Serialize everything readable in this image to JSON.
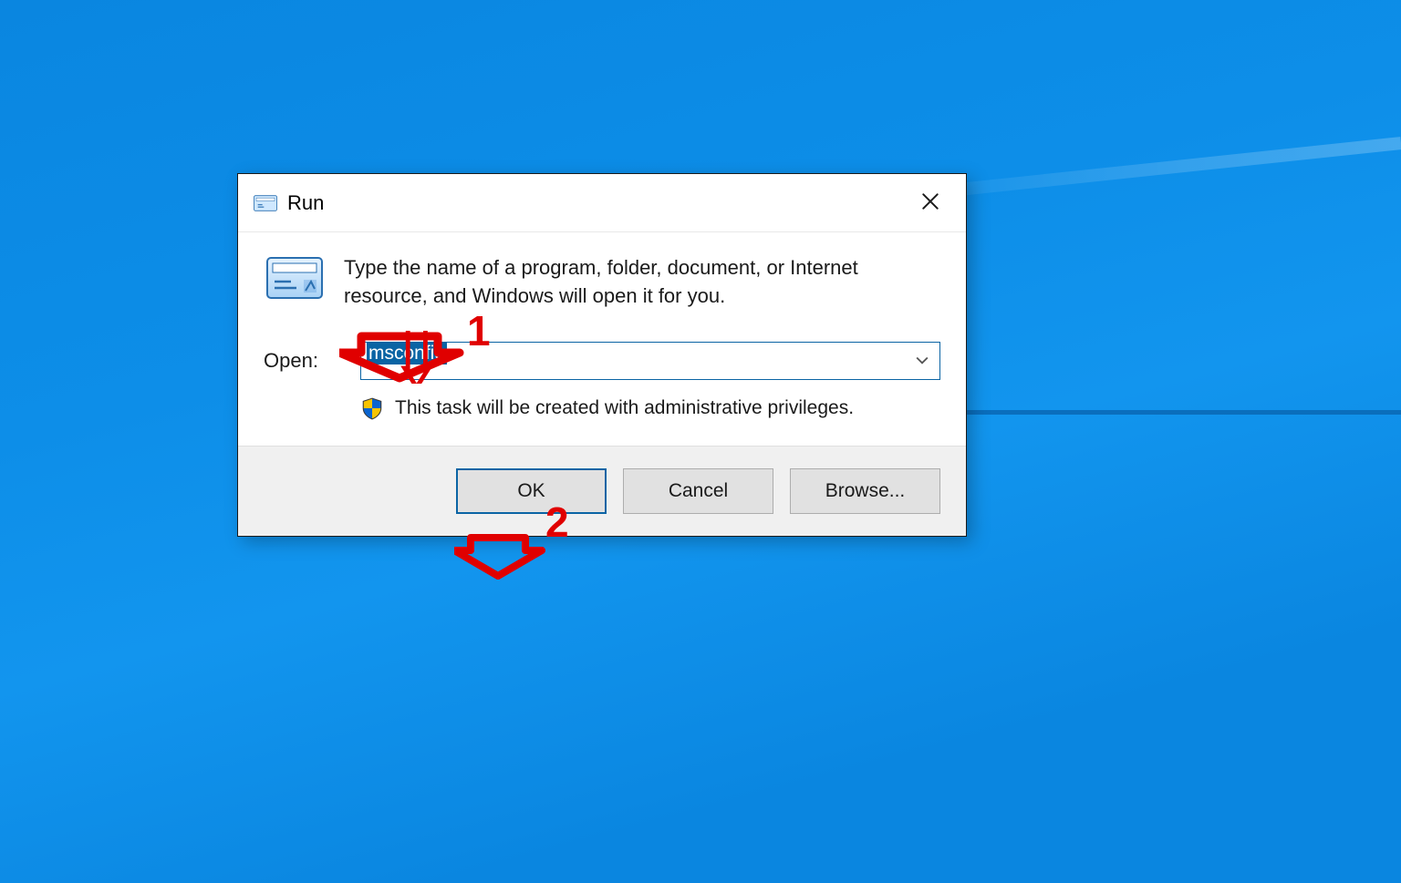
{
  "dialog": {
    "title": "Run",
    "description": "Type the name of a program, folder, document, or Internet resource, and Windows will open it for you.",
    "open_label": "Open:",
    "open_value": "msconfig",
    "admin_note": "This task will be created with administrative privileges.",
    "buttons": {
      "ok": "OK",
      "cancel": "Cancel",
      "browse": "Browse..."
    }
  },
  "annotations": {
    "step1": "1",
    "step2": "2"
  }
}
